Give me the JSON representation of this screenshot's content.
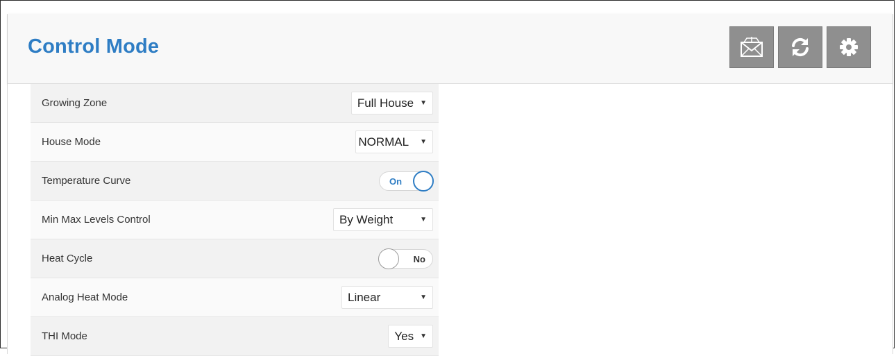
{
  "header": {
    "title": "Control Mode",
    "buttons": [
      {
        "icon": "envelope-icon"
      },
      {
        "icon": "refresh-icon"
      },
      {
        "icon": "gear-icon"
      }
    ]
  },
  "rows": [
    {
      "label": "Growing Zone",
      "control": "select",
      "value": "Full House"
    },
    {
      "label": "House Mode",
      "control": "select",
      "value": "NORMAL"
    },
    {
      "label": "Temperature Curve",
      "control": "toggle",
      "value": "On",
      "state": "on"
    },
    {
      "label": "Min Max Levels Control",
      "control": "select",
      "value": "By Weight"
    },
    {
      "label": "Heat Cycle",
      "control": "toggle",
      "value": "No",
      "state": "off"
    },
    {
      "label": "Analog Heat Mode",
      "control": "select",
      "value": "Linear"
    },
    {
      "label": "THI Mode",
      "control": "select",
      "value": "Yes"
    }
  ],
  "colors": {
    "title": "#2e7dc4",
    "toolbar_button": "#8f8f8f",
    "toggle_on": "#2e7dc4"
  }
}
